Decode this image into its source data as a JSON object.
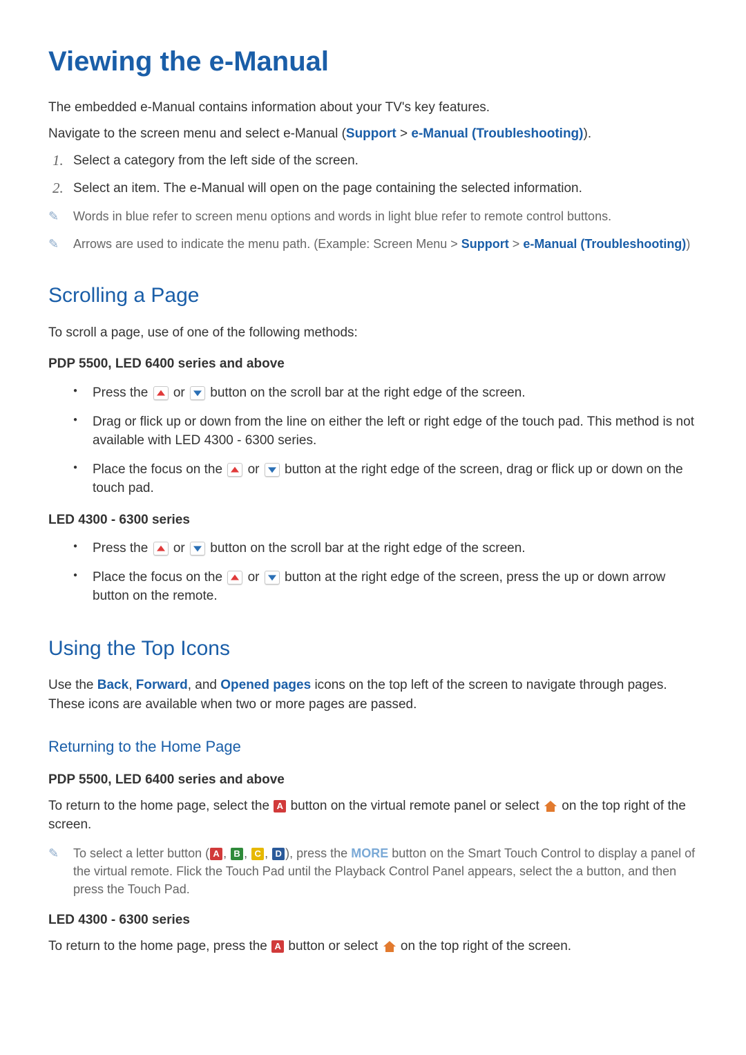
{
  "title": "Viewing the e-Manual",
  "intro": {
    "p1": "The embedded e-Manual contains information about your TV's key features.",
    "p2a": "Navigate to the screen menu and select e-Manual (",
    "nav_support": "Support",
    "nav_sep": " > ",
    "nav_emanual": "e-Manual (Troubleshooting)",
    "p2b": ")."
  },
  "steps": [
    {
      "n": "1.",
      "text": "Select a category from the left side of the screen."
    },
    {
      "n": "2.",
      "text": "Select an item. The e-Manual will open on the page containing the selected information."
    }
  ],
  "notes1": {
    "a": "Words in blue refer to screen menu options and words in light blue refer to remote control buttons.",
    "b1": "Arrows are used to indicate the menu path. (Example: Screen Menu > ",
    "b_support": "Support",
    "b_sep": " > ",
    "b_emanual": "e-Manual (Troubleshooting)",
    "b2": ")"
  },
  "scrolling": {
    "heading": "Scrolling a Page",
    "intro": "To scroll a page, use of one of the following methods:",
    "label1": "PDP 5500, LED 6400 series and above",
    "b1a": "Press the ",
    "b1b": " or ",
    "b1c": " button on the scroll bar at the right edge of the screen.",
    "b2": "Drag or flick up or down from the line on either the left or right edge of the touch pad. This method is not available with LED 4300 - 6300 series.",
    "b3a": "Place the focus on the ",
    "b3b": " or ",
    "b3c": " button at the right edge of the screen, drag or flick up or down on the touch pad.",
    "label2": "LED 4300 - 6300 series",
    "c1a": "Press the ",
    "c1b": " or ",
    "c1c": " button on the scroll bar at the right edge of the screen.",
    "c2a": "Place the focus on the ",
    "c2b": " or ",
    "c2c": " button at the right edge of the screen, press the up or down arrow button on the remote."
  },
  "topicons": {
    "heading": "Using the Top Icons",
    "p1a": "Use the ",
    "back": "Back",
    "sep1": ", ",
    "forward": "Forward",
    "sep2": ", and ",
    "opened": "Opened pages",
    "p1b": " icons on the top left of the screen to navigate through pages. These icons are available when two or more pages are passed."
  },
  "homepage": {
    "heading": "Returning to the Home Page",
    "label1": "PDP 5500, LED 6400 series and above",
    "p1a": "To return to the home page, select the ",
    "p1b": " button on the virtual remote panel or select ",
    "p1c": " on the top right of the screen.",
    "note_a": "To select a letter button (",
    "la": "A",
    "sep": ", ",
    "lb": "B",
    "lc": "C",
    "ld": "D",
    "note_b1": "), press the ",
    "more": "MORE",
    "note_b2": " button on the Smart Touch Control to display a panel of the virtual remote. Flick the Touch Pad until the Playback Control Panel appears, select the a button, and then press the Touch Pad.",
    "label2": "LED 4300 - 6300 series",
    "p2a": "To return to the home page, press the ",
    "p2b": " button or select ",
    "p2c": " on the top right of the screen."
  }
}
